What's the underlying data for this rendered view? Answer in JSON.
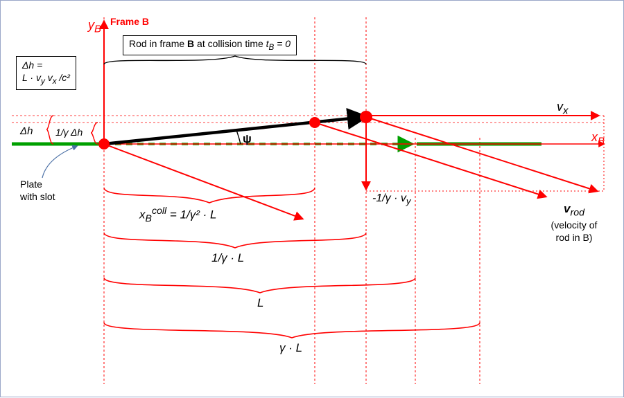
{
  "frame": {
    "title": "Frame B",
    "axis_y": "y",
    "axis_y_sub": "B",
    "axis_x": "x",
    "axis_x_sub": "B"
  },
  "rodbox": {
    "title_prefix": "Rod in frame ",
    "title_bold": "B",
    "title_suffix": " at collision time ",
    "time_sym_prefix": "t",
    "time_sym_sub": "B",
    "time_sym_suffix": " = 0"
  },
  "dhbox": {
    "line1": "Δh   =",
    "line2": "L · v",
    "line2_sub1": "y",
    "line2_mid": " v",
    "line2_sub2": "x",
    "line2_tail": " /c²"
  },
  "dh_small": "Δh",
  "one_over_gamma_dh": "1/γ Δh",
  "psi": "ψ",
  "vx": {
    "prefix": "v",
    "sub": "x"
  },
  "minusvy": {
    "prefix": "-1/γ  · v",
    "sub": "y"
  },
  "vrod": {
    "prefix": "v",
    "sub": "rod",
    "line2": "(velocity of",
    "line3": "rod in B)"
  },
  "plate": {
    "line1": "Plate",
    "line2": "with slot"
  },
  "b1": {
    "prefix": "x",
    "sub": "B",
    "sup": "coll",
    "tail": " = 1/γ² · L"
  },
  "b2": "1/γ · L",
  "b3": "L",
  "b4": "γ · L"
}
